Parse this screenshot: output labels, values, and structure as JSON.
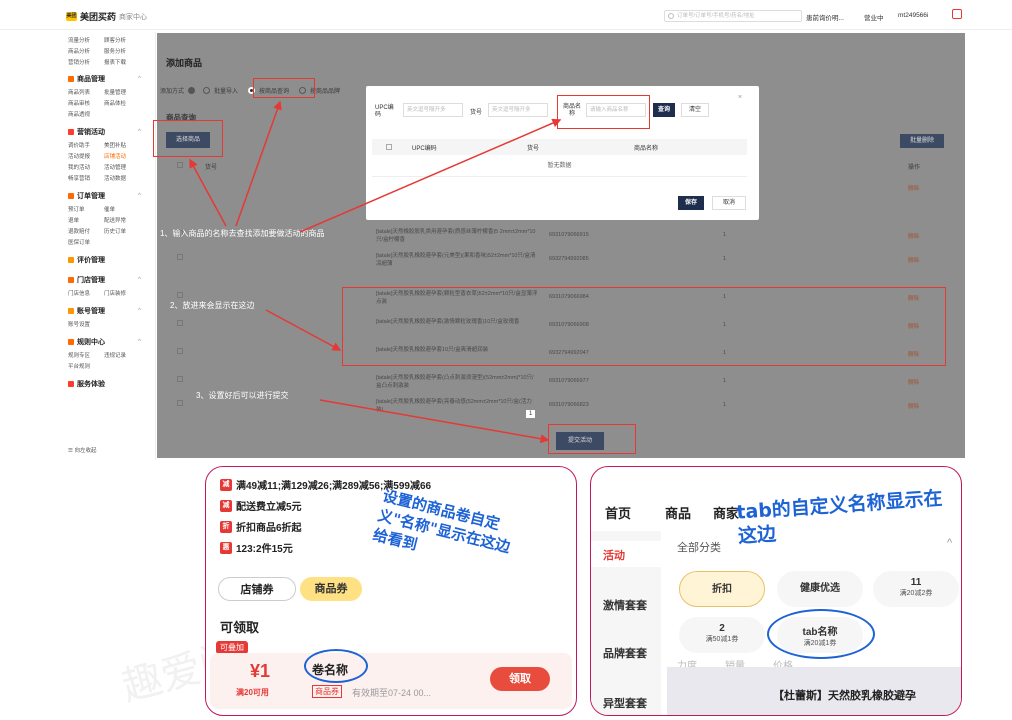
{
  "topbar": {
    "logo_badge": "美团",
    "brand_name": "美团买药",
    "brand_sub": "商家中心",
    "search_placeholder": "订单号/订单号/手机号/药名/地址",
    "menu_items": [
      "患前询价明...",
      "营业中",
      "mt249566i"
    ]
  },
  "sidebar": {
    "top_rows": [
      [
        "流量分析",
        "顾客分析"
      ],
      [
        "商品分析",
        "服务分析"
      ],
      [
        "营销分析",
        "报表下载"
      ]
    ],
    "sections": [
      {
        "title": "商品管理",
        "color": "#ff6a00",
        "rows": [
          [
            "商品列表",
            "批量管理"
          ],
          [
            "商品审核",
            "商品体检"
          ],
          [
            "商品透视",
            ""
          ]
        ]
      },
      {
        "title": "营销活动",
        "color": "#ff3b30",
        "rows": [
          [
            "调价助手",
            "美团补贴"
          ],
          [
            "活动提报",
            "店铺活动"
          ],
          [
            "我的活动",
            "活动管理"
          ],
          [
            "畅享营销",
            "活动数据"
          ]
        ]
      },
      {
        "title": "订单管理",
        "color": "#ff6a00",
        "rows": [
          [
            "预订单",
            "催单"
          ],
          [
            "退单",
            "配送异常"
          ],
          [
            "退款赔付",
            "历史订单"
          ],
          [
            "医保订单",
            ""
          ]
        ]
      },
      {
        "title": "评价管理",
        "color": "#ff9500",
        "rows": []
      },
      {
        "title": "门店管理",
        "color": "#ff6a00",
        "rows": [
          [
            "门店信息",
            "门店装修"
          ]
        ]
      },
      {
        "title": "账号管理",
        "color": "#ff9500",
        "rows": [
          [
            "账号设置",
            ""
          ]
        ]
      },
      {
        "title": "规则中心",
        "color": "#ff6a00",
        "rows": [
          [
            "规则专区",
            "违规记录"
          ],
          [
            "平台规则",
            ""
          ]
        ]
      },
      {
        "title": "服务体验",
        "color": "#ff3b30",
        "rows": []
      }
    ],
    "footer": "向左收起"
  },
  "page": {
    "title": "添加商品",
    "add_method_label": "添加方式",
    "methods": [
      "批量导入",
      "按商品查询",
      "按商品品牌"
    ],
    "query_label": "商品查询",
    "select_button": "选择商品",
    "bulk_delete_button": "批量删除",
    "col_code": "货号",
    "col_action": "操作",
    "rows": [
      {
        "name": "[tatale]天然橡胶胶乳类用避孕套(质感丝薄柠檬香)5 2mm±2mm*10只/盒柠檬香",
        "code": "6931079066915",
        "qty": "1",
        "action": "删除"
      },
      {
        "name": "[tatale]天然胶乳橡胶避孕套(元美型)(果和香味)52±2mm*10只/盒清凉超薄",
        "code": "6932794992085",
        "qty": "1",
        "action": "删除"
      },
      {
        "name": "[tatale]天然胶乳橡胶避孕套(颗粒型香衣草)52±2mm*10只/盒显薄浮点装",
        "code": "6931079066984",
        "qty": "1",
        "action": "删除"
      },
      {
        "name": "[tatale]天然胶乳橡胶避孕套(激情颗粒玫瑰香)10只/盒玫瑰香",
        "code": "6931079066908",
        "qty": "1",
        "action": "删除"
      },
      {
        "name": "[tatale]天然胶乳橡胶避孕套10只/盒爽滑超润装",
        "code": "6932794992047",
        "qty": "1",
        "action": "删除"
      },
      {
        "name": "[tatale]天然胶乳橡胶避孕套(凸点刺激浪漫型)(52mm±2mm)*10只/盒凸点刺激装",
        "code": "6931079066977",
        "qty": "1",
        "action": "删除"
      },
      {
        "name": "[tatale]天然胶乳橡胶避孕套(亮春动感(52mm±2mm*10只/盒(活力装)",
        "code": "6931079066823",
        "qty": "1",
        "action": "删除"
      }
    ],
    "page_num": "1",
    "submit_button": "提交活动"
  },
  "modal": {
    "upc_label": "UPC编码",
    "upc_placeholder": "英文逗号隔开多",
    "code_label": "货号",
    "code_placeholder": "英文逗号隔开多",
    "name_label": "商品名称",
    "name_placeholder": "请输入商品名称",
    "query_button": "查询",
    "clear_button": "清空",
    "col_upc": "UPC编码",
    "col_code": "货号",
    "col_name": "商品名称",
    "empty": "暂无数据",
    "save_button": "保存",
    "cancel_button": "取消",
    "close": "×"
  },
  "annotations": [
    "1、输入商品的名称去查找添加要做活动的商品",
    "2、放进来会显示在这边",
    "3、设置好后可以进行提交"
  ],
  "phone1": {
    "promos": [
      {
        "tag": "减",
        "color": "#e53935",
        "text": "满49减11;满129减26;满289减56;满599减66"
      },
      {
        "tag": "减",
        "color": "#e53935",
        "text": "配送费立减5元"
      },
      {
        "tag": "折",
        "color": "#e53935",
        "text": "折扣商品6折起"
      },
      {
        "tag": "惠",
        "color": "#e53935",
        "text": "123:2件15元"
      }
    ],
    "pill_store": "店铺券",
    "pill_goods": "商品券",
    "section": "可领取",
    "stackable": "可叠加",
    "price": "¥1",
    "coupon_name": "卷名称",
    "condition": "满20可用",
    "badge": "商品券",
    "expiry": "有效期至07-24 00...",
    "claim": "领取",
    "hand_note": "设置的商品卷自定义\"名称\"显示在这边给看到"
  },
  "phone2": {
    "tabs": [
      "首页",
      "商品",
      "商家"
    ],
    "nav": [
      "活动",
      "激情套套",
      "品牌套套",
      "异型套套"
    ],
    "category": "全部分类",
    "chips": [
      {
        "t": "折扣",
        "s": ""
      },
      {
        "t": "健康优选",
        "s": ""
      },
      {
        "t": "11",
        "s": "满20减2券"
      },
      {
        "t": "2",
        "s": "满50减1券"
      },
      {
        "t": "tab名称",
        "s": "满20减1券"
      }
    ],
    "faded": [
      "力度",
      "销量",
      "价格"
    ],
    "product": "【杜蕾斯】天然胶乳橡胶避孕",
    "hand_note": "tab的自定义名称显示在这边"
  }
}
